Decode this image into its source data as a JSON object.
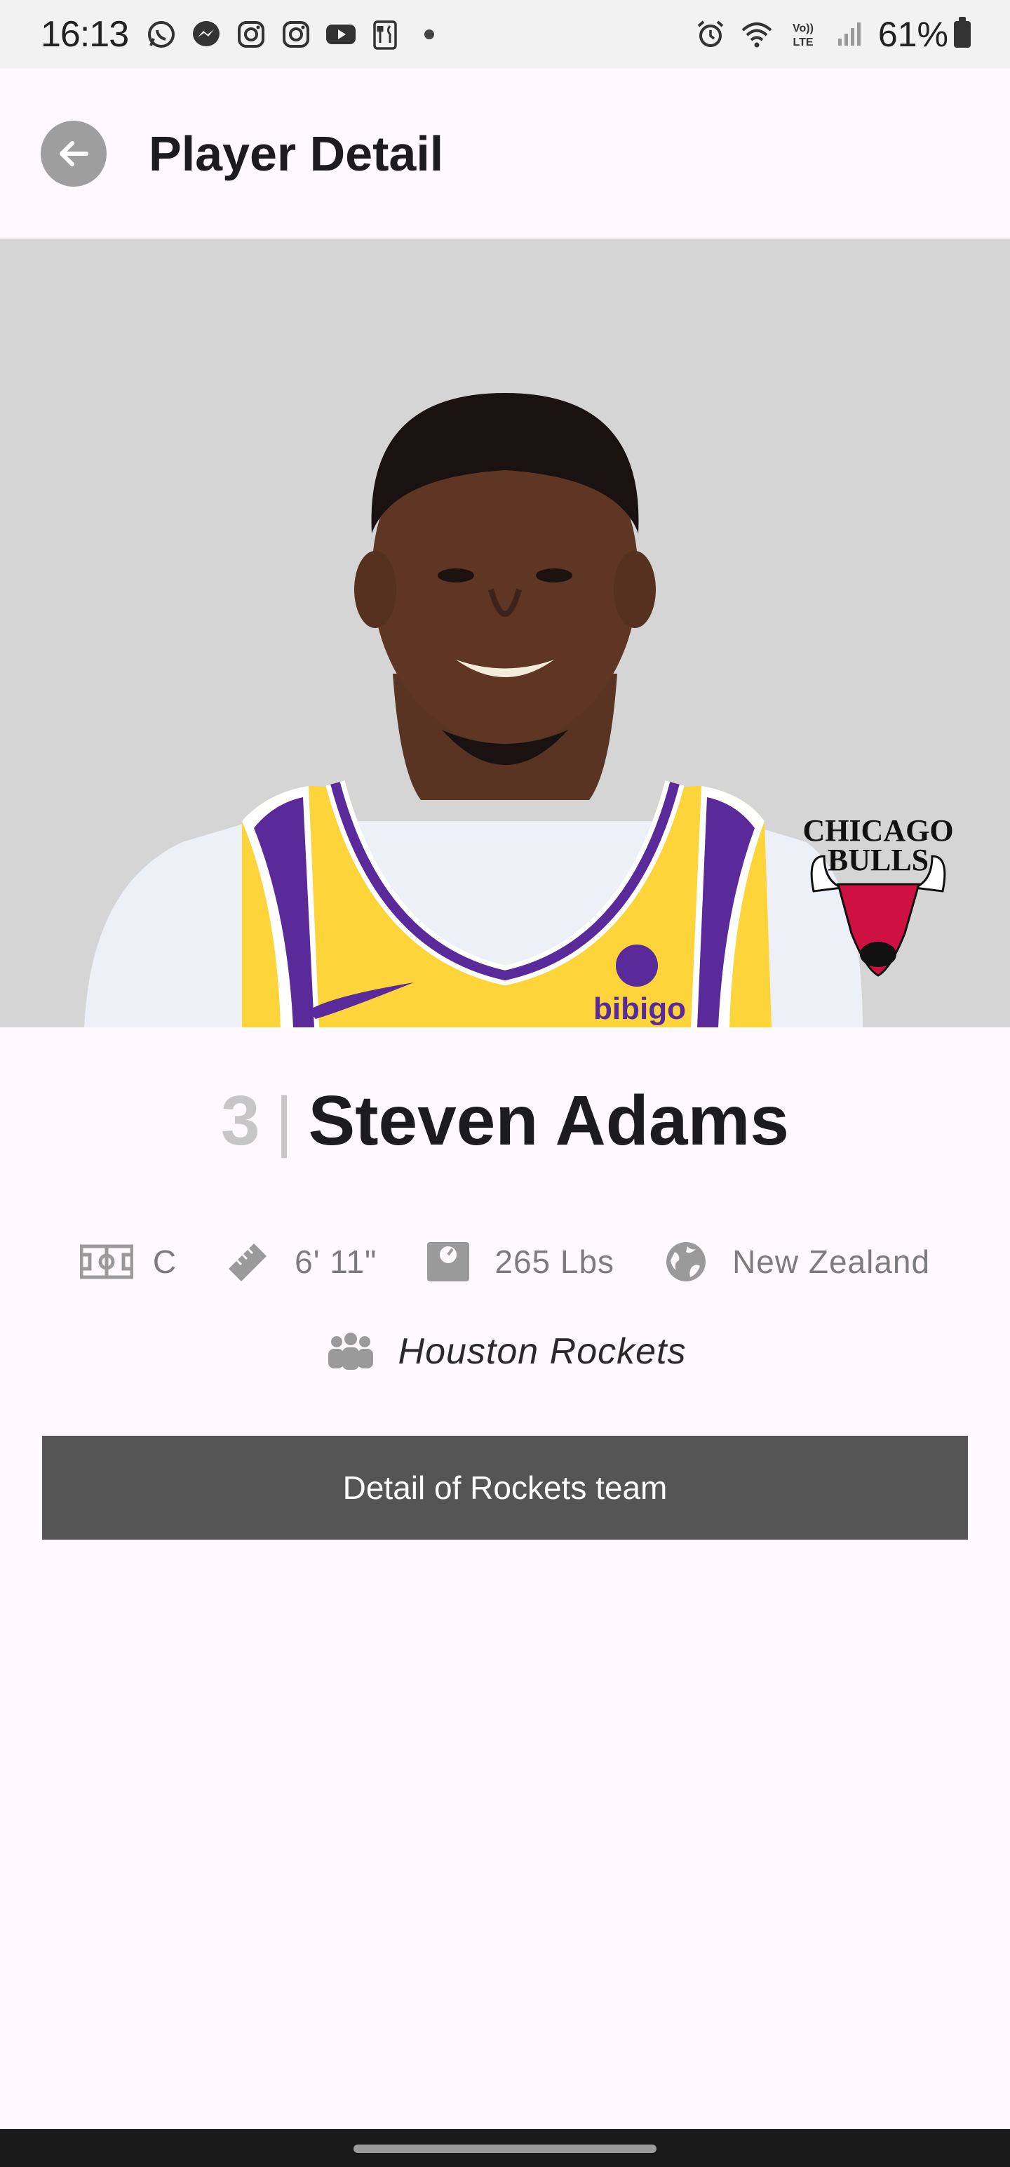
{
  "status_bar": {
    "time": "16:13",
    "battery": "61%",
    "left_icons": [
      "whatsapp-icon",
      "messenger-icon",
      "instagram-icon",
      "instagram-icon",
      "youtube-icon",
      "restaurant-icon"
    ],
    "right_icons": [
      "alarm-icon",
      "wifi-icon",
      "volte-icon",
      "signal-icon",
      "battery-icon"
    ]
  },
  "app_bar": {
    "title": "Player Detail"
  },
  "player": {
    "number": "3",
    "separator": "|",
    "name": "Steven Adams",
    "position": "C",
    "height": "6' 11\"",
    "weight": "265 Lbs",
    "country": "New Zealand",
    "team": "Houston Rockets"
  },
  "hero": {
    "team_logo_text_line1": "CHICAGO",
    "team_logo_text_line2": "BULLS",
    "jersey_sponsor": "bibigo",
    "background_color": "#d5d5d5",
    "jersey_color": "#fdd43a",
    "trim_color": "#5a2a9a"
  },
  "actions": {
    "team_button": "Detail of Rockets team"
  },
  "colors": {
    "accent_gray": "#555555",
    "muted_text": "#7c7c7c"
  }
}
